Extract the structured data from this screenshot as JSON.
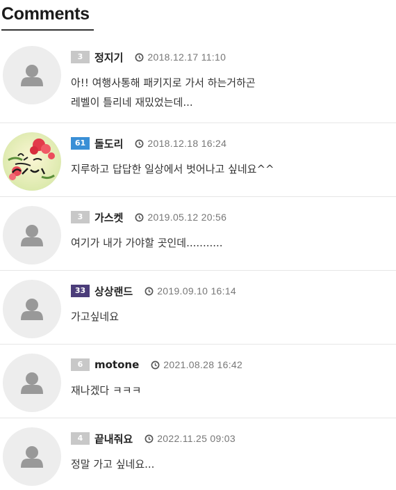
{
  "section": {
    "title": "Comments"
  },
  "icons": {
    "clock": "clock-icon",
    "default_avatar": "user-silhouette-icon"
  },
  "comments": [
    {
      "level": "3",
      "level_color": "#c8c8c8",
      "nickname": "정지기",
      "date": "2018.12.17 11:10",
      "lines": [
        "아!! 여행사통해 패키지로 가서 하는거하곤",
        "레벨이 틀리네 재밌었는데..."
      ],
      "avatar": "default"
    },
    {
      "level": "61",
      "level_color": "#3a8fd6",
      "nickname": "돌도리",
      "date": "2018.12.18 16:24",
      "lines": [
        "지루하고 답답한 일상에서 벗어나고 싶네요^^"
      ],
      "avatar": "custom"
    },
    {
      "level": "3",
      "level_color": "#c8c8c8",
      "nickname": "가스켓",
      "date": "2019.05.12 20:56",
      "lines": [
        "여기가 내가 가야할 곳인데..........."
      ],
      "avatar": "default"
    },
    {
      "level": "33",
      "level_color": "#4b3d7a",
      "nickname": "상상랜드",
      "date": "2019.09.10 16:14",
      "lines": [
        "가고싶네요"
      ],
      "avatar": "default"
    },
    {
      "level": "6",
      "level_color": "#c8c8c8",
      "nickname": "motone",
      "date": "2021.08.28 16:42",
      "lines": [
        "재나겠다 ㅋㅋㅋ"
      ],
      "avatar": "default"
    },
    {
      "level": "4",
      "level_color": "#c8c8c8",
      "nickname": "끝내줘요",
      "date": "2022.11.25 09:03",
      "lines": [
        "정말 가고 싶네요..."
      ],
      "avatar": "default"
    }
  ]
}
